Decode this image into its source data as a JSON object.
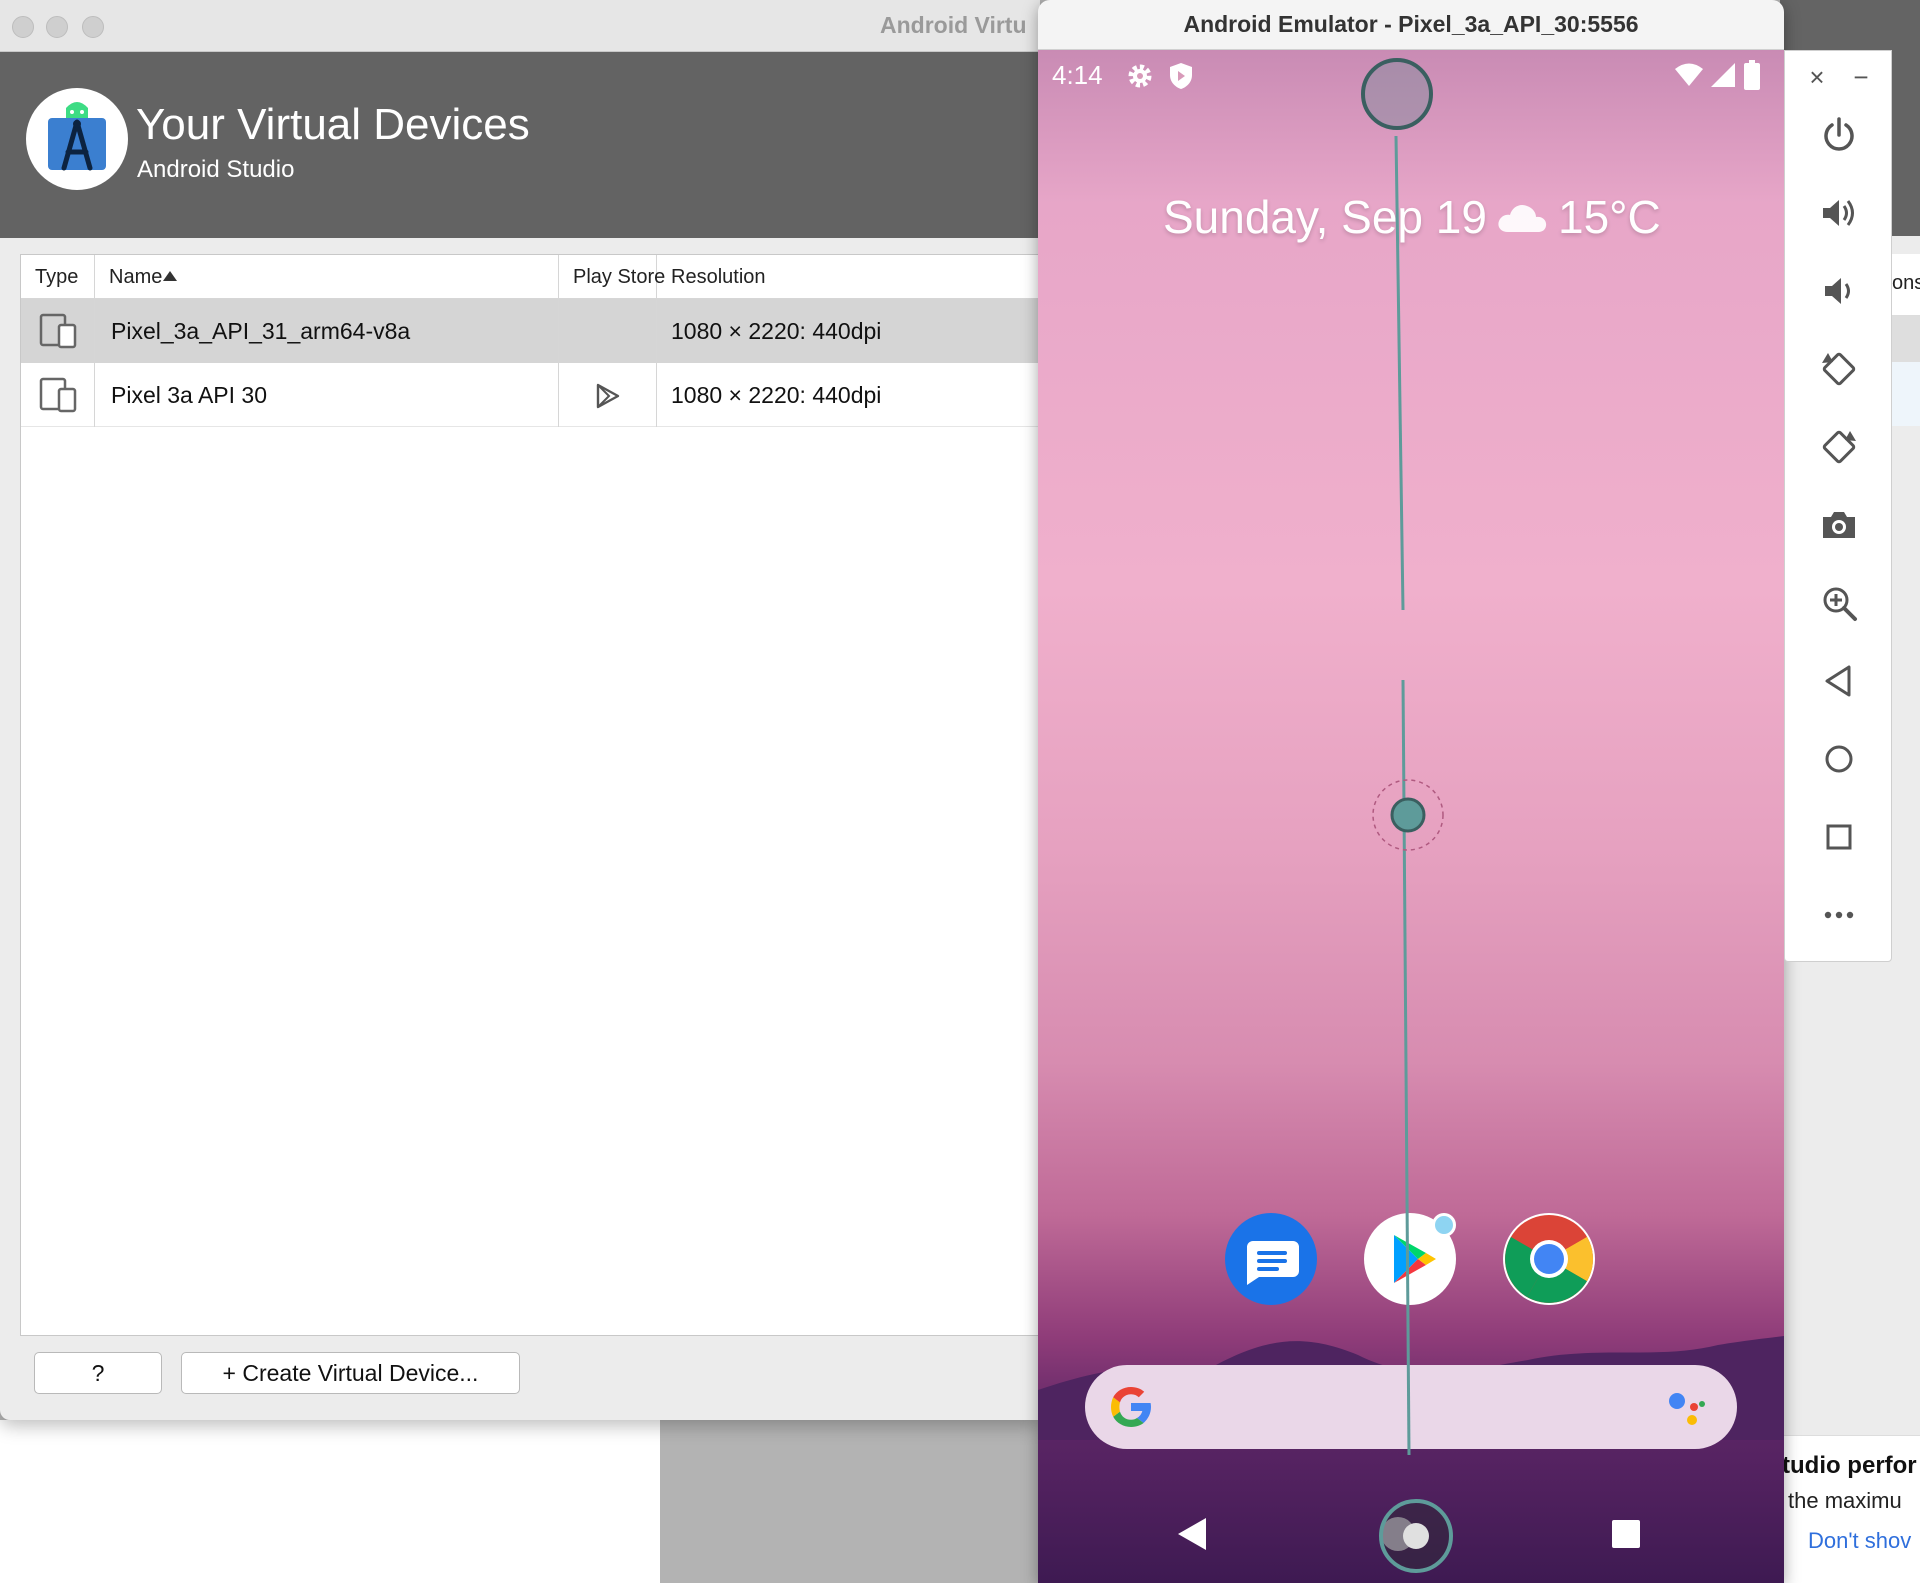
{
  "avd_window": {
    "title": "Android Virtu",
    "header_title": "Your Virtual Devices",
    "header_subtitle": "Android Studio",
    "columns": {
      "type": "Type",
      "name": "Name",
      "play_store": "Play Store",
      "resolution": "Resolution"
    },
    "sort_indicator": "sort-ascending-icon",
    "devices": [
      {
        "name": "Pixel_3a_API_31_arm64-v8a",
        "play_store": "",
        "resolution": "1080 × 2220: 440dpi",
        "selected": true
      },
      {
        "name": "Pixel 3a API 30",
        "play_store": "play-store-icon",
        "resolution": "1080 × 2220: 440dpi",
        "selected": false
      }
    ],
    "help_label": "?",
    "create_label": "+ Create Virtual Device..."
  },
  "behind_panel": {
    "column_fragment": "ons",
    "notice_title": "tudio perfor",
    "notice_body": "the maximu",
    "notice_link": "Don't shov"
  },
  "emulator": {
    "title": "Android Emulator - Pixel_3a_API_30:5556",
    "status_time": "4:14",
    "date_text": "Sunday, Sep 19",
    "temperature": "15°C",
    "weather_icon": "cloud-icon",
    "dock_apps": [
      "messages-icon",
      "play-store-icon",
      "chrome-icon"
    ],
    "toolbar": {
      "close_label": "×",
      "minimize_label": "−",
      "tools": [
        "power-icon",
        "volume-up-icon",
        "volume-down-icon",
        "rotate-left-icon",
        "rotate-right-icon",
        "camera-icon",
        "zoom-icon",
        "back-icon",
        "home-icon",
        "overview-icon",
        "more-icon"
      ]
    }
  },
  "colors": {
    "header_bg": "#636363",
    "selected_row": "#d5d5d5",
    "accent_teal": "#5e9b9a",
    "link_blue": "#2f6fdc"
  }
}
